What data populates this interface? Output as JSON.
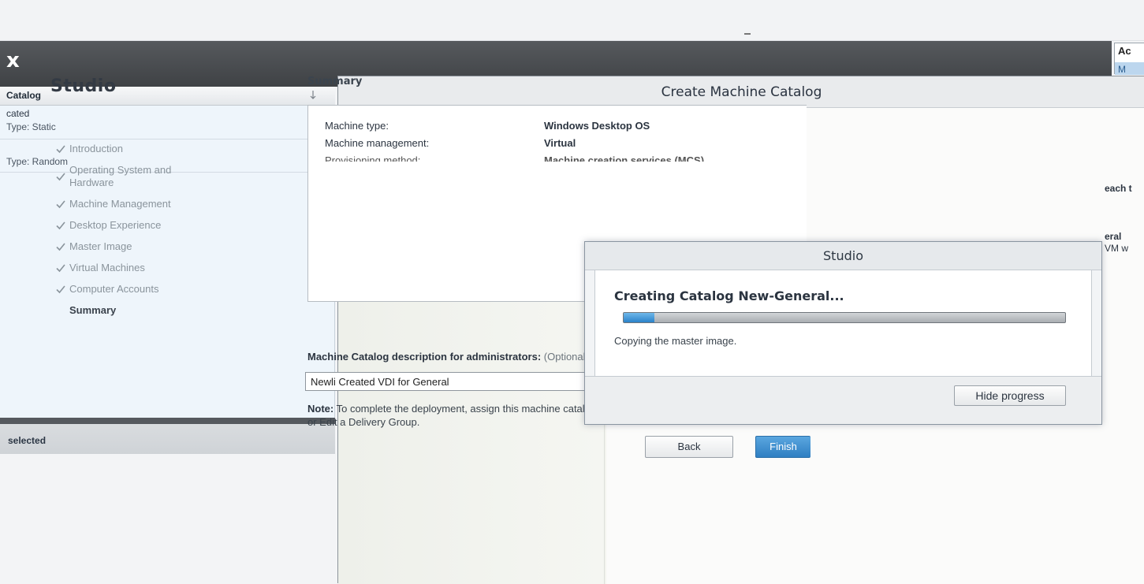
{
  "console": {
    "title_fragment": "x",
    "actions_label": "Ac",
    "actions_item": "M"
  },
  "catalog_list": {
    "column_header": "Catalog",
    "rows": [
      {
        "line1": "cated",
        "line2": "Type: Static"
      },
      {
        "line1": "",
        "line2": "Type: Random"
      }
    ],
    "footer": "selected"
  },
  "wizard": {
    "title": "Create Machine Catalog",
    "brand": "Studio",
    "steps": [
      "Introduction",
      "Operating System and Hardware",
      "Machine Management",
      "Desktop Experience",
      "Master Image",
      "Virtual Machines",
      "Computer Accounts"
    ],
    "current_step": "Summary",
    "section_title": "Summary",
    "summary": [
      {
        "label": "Machine type:",
        "value": "Windows Desktop OS"
      },
      {
        "label": "Machine management:",
        "value": "Virtual"
      },
      {
        "label": "Provisioning method:",
        "value": "Machine creation services (MCS)"
      }
    ],
    "clipped_right": [
      "each t",
      "eral",
      "VM w"
    ],
    "description_label": "Machine Catalog description for administrators:",
    "description_optional": "(Optional)",
    "description_value": "Newli Created VDI for General",
    "note_bold": "Note:",
    "note_text": "To complete the deployment, assign this machine catalog to a Delive Delivery Groups and then Create or Edit a Delivery Group.",
    "back_label": "Back",
    "finish_label": "Finish"
  },
  "progress": {
    "title": "Studio",
    "heading": "Creating Catalog New-General...",
    "status": "Copying the master image.",
    "percent": 7,
    "hide_label": "Hide progress"
  },
  "colors": {
    "accent": "#2a82c9",
    "console_band": "#4a4d51",
    "selection_bg": "#eef5fb"
  },
  "icons": [
    "check-icon",
    "sort-arrow-icon"
  ]
}
